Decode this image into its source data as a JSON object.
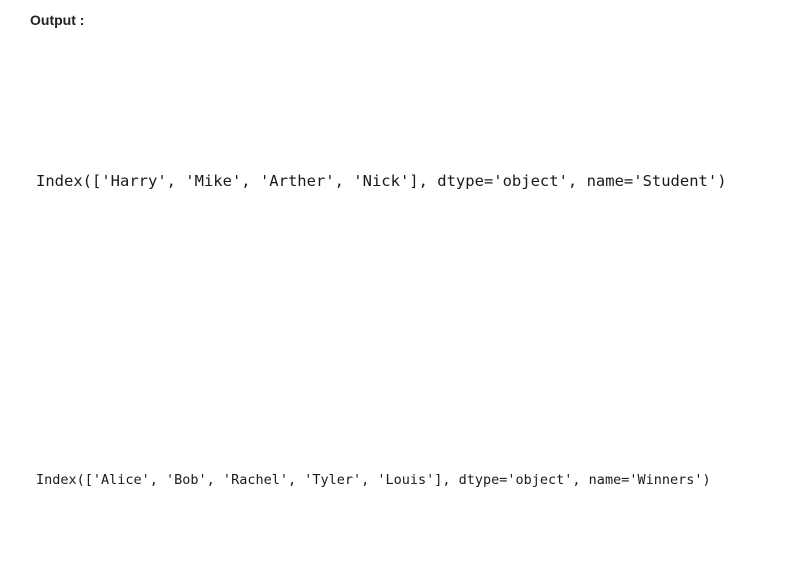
{
  "heading": "Output :",
  "outputs": [
    "Index(['Harry', 'Mike', 'Arther', 'Nick'], dtype='object', name='Student')",
    "Index(['Alice', 'Bob', 'Rachel', 'Tyler', 'Louis'], dtype='object', name='Winners')"
  ]
}
